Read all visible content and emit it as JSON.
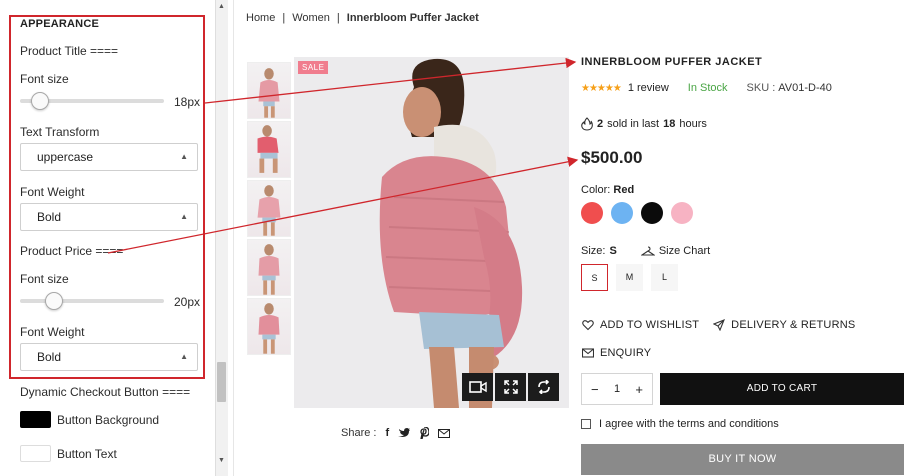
{
  "left_panel": {
    "section_title": "APPEARANCE",
    "product_title_heading": "Product Title ====",
    "title_font_size_label": "Font size",
    "title_font_size_value": "18px",
    "text_transform_label": "Text Transform",
    "text_transform_value": "uppercase",
    "title_font_weight_label": "Font Weight",
    "title_font_weight_value": "Bold",
    "product_price_heading": "Product Price ====",
    "price_font_size_label": "Font size",
    "price_font_size_value": "20px",
    "price_font_weight_label": "Font Weight",
    "price_font_weight_value": "Bold",
    "dynamic_checkout_heading": "Dynamic Checkout Button ====",
    "button_background_label": "Button Background",
    "button_background_color": "#000000",
    "button_text_label": "Button Text",
    "button_text_color": "#ffffff"
  },
  "breadcrumb": {
    "home": "Home",
    "sep1": "|",
    "category": "Women",
    "sep2": "|",
    "current": "Innerbloom Puffer Jacket"
  },
  "gallery": {
    "sale_badge": "SALE",
    "share_label": "Share :"
  },
  "product": {
    "title": "INNERBLOOM PUFFER JACKET",
    "stars": "★★★★★",
    "review_count": "1 review",
    "stock_status": "In Stock",
    "sku_label": "SKU :",
    "sku_value": "AV01-D-40",
    "sold_count": "2",
    "sold_text_1": "sold in last",
    "sold_hours": "18",
    "sold_text_2": "hours",
    "price": "$500.00",
    "color_label": "Color:",
    "color_value": "Red",
    "swatches": [
      "#f04e4e",
      "#6db3f2",
      "#0b0b0b",
      "#f7b3c3"
    ],
    "size_label": "Size:",
    "size_value": "S",
    "size_chart_label": "Size Chart",
    "sizes": [
      "S",
      "M",
      "L"
    ],
    "wishlist_label": "ADD TO WISHLIST",
    "delivery_label": "DELIVERY & RETURNS",
    "enquiry_label": "ENQUIRY",
    "qty_minus": "−",
    "qty_value": "1",
    "qty_plus": "+",
    "add_to_cart_label": "ADD TO CART",
    "terms_label": "I agree with the terms and conditions",
    "buy_now_label": "BUY IT NOW"
  },
  "colors": {
    "accent_red": "#d0262c",
    "in_stock_green": "#4aa545",
    "star_orange": "#f6a01a",
    "buy_now_gray": "#8a8a8a"
  }
}
